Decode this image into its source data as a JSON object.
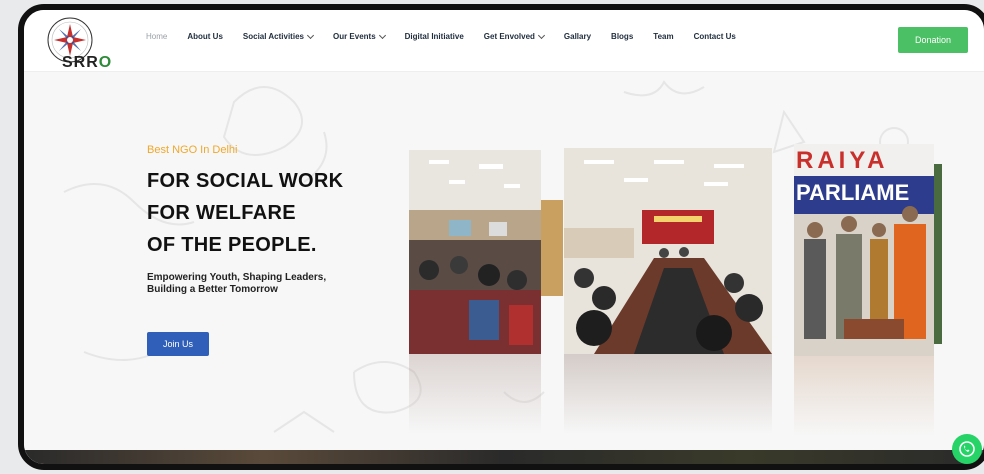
{
  "logo": {
    "text_main": "SRR",
    "text_o": "O",
    "alt": "SRRO logo"
  },
  "nav": {
    "items": [
      {
        "label": "Home",
        "active": true,
        "dropdown": false
      },
      {
        "label": "About Us",
        "active": false,
        "dropdown": false
      },
      {
        "label": "Social Activities",
        "active": false,
        "dropdown": true
      },
      {
        "label": "Our Events",
        "active": false,
        "dropdown": true
      },
      {
        "label": "Digital Initiative",
        "active": false,
        "dropdown": false
      },
      {
        "label": "Get Envolved",
        "active": false,
        "dropdown": true
      },
      {
        "label": "Gallary",
        "active": false,
        "dropdown": false
      },
      {
        "label": "Blogs",
        "active": false,
        "dropdown": false
      },
      {
        "label": "Team",
        "active": false,
        "dropdown": false
      },
      {
        "label": "Contact Us",
        "active": false,
        "dropdown": false
      }
    ],
    "donate_label": "Donation"
  },
  "hero": {
    "tag": "Best NGO In Delhi",
    "headline": [
      "FOR SOCIAL WORK",
      "FOR WELFARE",
      "OF THE PEOPLE."
    ],
    "sub": [
      "Empowering Youth, Shaping Leaders,",
      "Building a Better Tomorrow"
    ],
    "join_label": "Join Us",
    "slide3_banner": [
      "RAIYA",
      "PARLIAME"
    ]
  },
  "colors": {
    "accent_green": "#4bc064",
    "join_blue": "#2f5fb9",
    "tag_orange": "#f0a82a",
    "whatsapp": "#25d366"
  }
}
